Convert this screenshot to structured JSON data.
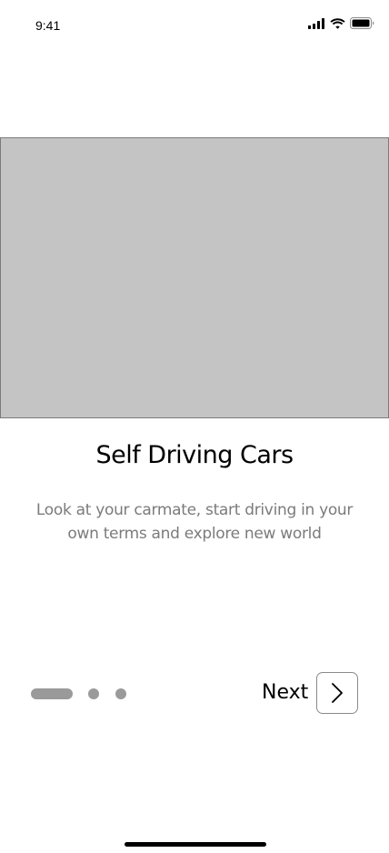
{
  "status_bar": {
    "time": "9:41",
    "icons": [
      "signal-icon",
      "wifi-icon",
      "battery-icon"
    ]
  },
  "onboarding": {
    "title": "Self Driving Cars",
    "description": "Look at your carmate, start driving in your own terms and explore new world",
    "page_indicator": {
      "current_page": 1,
      "total_pages": 3
    },
    "next_label": "Next",
    "next_icon": "chevron-right-icon"
  },
  "colors": {
    "image_placeholder": "#c4c4c4",
    "description_text": "#7b7b7b",
    "dots": "#9a9a9a"
  }
}
